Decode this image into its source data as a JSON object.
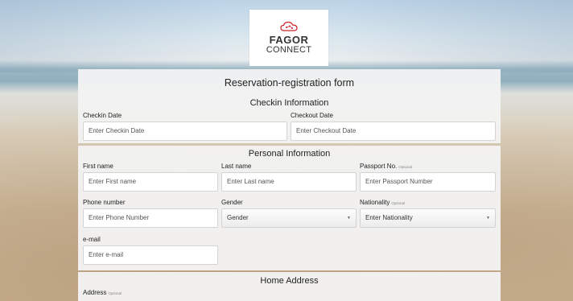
{
  "logo": {
    "line1": "FAGOR",
    "line2": "CONNECT",
    "icon": "cloud-network-icon",
    "accent": "#d0202a"
  },
  "form": {
    "title": "Reservation-registration form",
    "checkin_section": {
      "title": "Checkin Information",
      "checkin_label": "Checkin Date",
      "checkin_placeholder": "Enter Checkin Date",
      "checkout_label": "Checkout Date",
      "checkout_placeholder": "Enter Checkout Date"
    },
    "personal_section": {
      "title": "Personal Information",
      "first_name_label": "First name",
      "first_name_placeholder": "Enter First name",
      "last_name_label": "Last name",
      "last_name_placeholder": "Enter Last name",
      "passport_label": "Passport No.",
      "passport_placeholder": "Enter Passport Number",
      "phone_label": "Phone number",
      "phone_placeholder": "Enter Phone Number",
      "gender_label": "Gender",
      "gender_value": "Gender",
      "nationality_label": "Nationality",
      "nationality_value": "Enter Nationality",
      "email_label": "e-mail",
      "email_placeholder": "Enter e-mail"
    },
    "address_section": {
      "title": "Home Address",
      "address_label": "Address"
    },
    "optional_text": "Optional"
  }
}
